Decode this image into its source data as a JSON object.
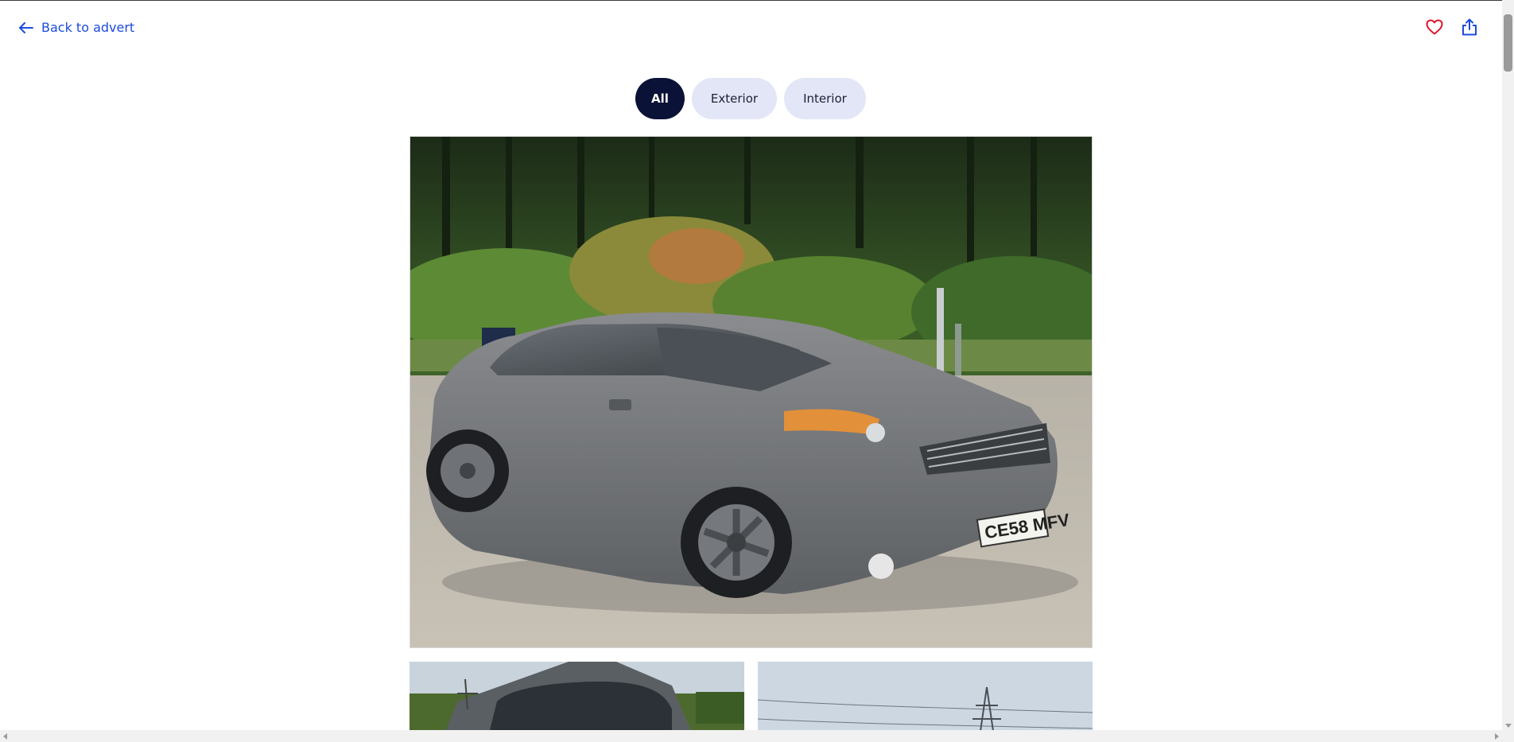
{
  "nav": {
    "back_label": "Back to advert",
    "back_icon": "arrow-left-icon",
    "favourite_icon": "heart-icon",
    "share_icon": "share-icon"
  },
  "filters": [
    {
      "label": "All",
      "active": true
    },
    {
      "label": "Exterior",
      "active": false
    },
    {
      "label": "Interior",
      "active": false
    }
  ],
  "gallery": {
    "main_photo": {
      "subject": "grey saloon car parked on gravel in front of trees",
      "number_plate": "CE58 MFV"
    },
    "thumbnails": [
      {
        "subject": "front view of car with pylon in background"
      },
      {
        "subject": "sky with electricity pylon"
      }
    ]
  },
  "colors": {
    "accent_blue": "#1b4be0",
    "chip_active_bg": "#0b1238",
    "chip_inactive_bg": "#e3e6f7",
    "heart_red": "#e0112b"
  }
}
